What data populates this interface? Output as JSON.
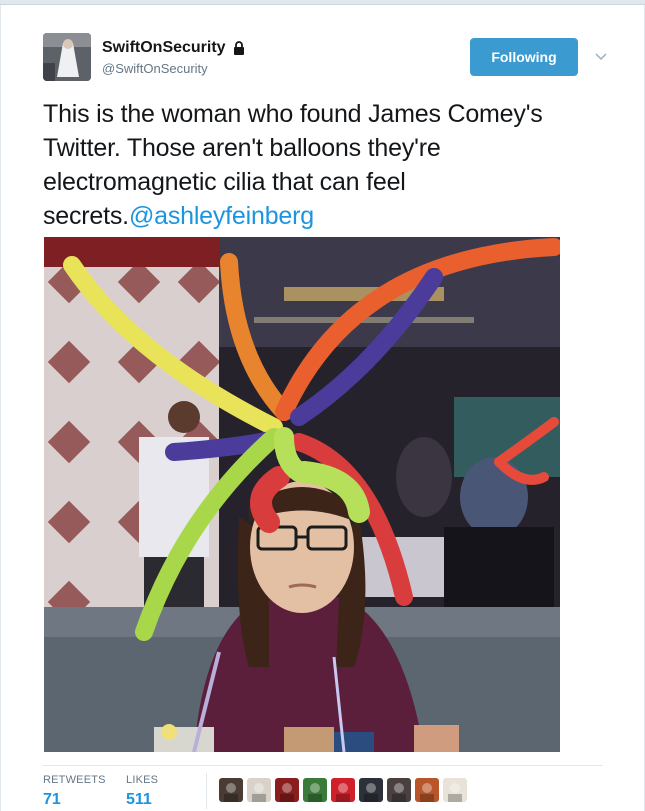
{
  "author": {
    "display_name": "SwiftOnSecurity",
    "handle": "@SwiftOnSecurity",
    "protected_icon": "lock-icon",
    "avatar_icon": "avatar"
  },
  "follow_button": {
    "label": "Following"
  },
  "tweet": {
    "text": "This is the woman who found James Comey's Twitter. Those aren't balloons they're electromagnetic cilia that can feel secrets.",
    "mention": "@ashleyfeinberg"
  },
  "stats": {
    "retweets_label": "RETWEETS",
    "retweets_count": "71",
    "likes_label": "LIKES",
    "likes_count": "511"
  },
  "liker_avatars": [
    {
      "color": "#4a3b34"
    },
    {
      "color": "#d8d2c8"
    },
    {
      "color": "#8a1e1e"
    },
    {
      "color": "#3a7a3a"
    },
    {
      "color": "#d0202a"
    },
    {
      "color": "#2c3038"
    },
    {
      "color": "#4a4040"
    },
    {
      "color": "#b8552a"
    },
    {
      "color": "#e8e2d8"
    }
  ],
  "colors": {
    "accent": "#1b95e0",
    "follow_button": "#3b9bd0"
  }
}
